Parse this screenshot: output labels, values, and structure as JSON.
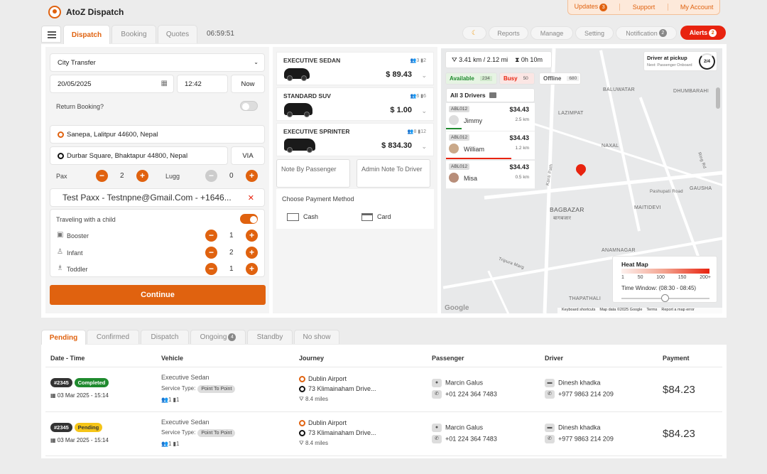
{
  "app": {
    "title": "AtoZ Dispatch"
  },
  "toplinks": {
    "updates": "Updates",
    "updates_count": "3",
    "support": "Support",
    "account": "My Account"
  },
  "tabs": [
    {
      "label": "Dispatch"
    },
    {
      "label": "Booking"
    },
    {
      "label": "Quotes"
    }
  ],
  "clock": "06:59:51",
  "right_tabs": {
    "theme": "☾",
    "reports": "Reports",
    "manage": "Manage",
    "setting": "Setting",
    "notification": "Notification",
    "notification_count": "2",
    "alerts": "Alerts",
    "alerts_count": "2"
  },
  "booking": {
    "transfer_type": "City Transfer",
    "date": "20/05/2025",
    "time": "12:42",
    "now_label": "Now",
    "return_label": "Return Booking?",
    "pickup": "Sanepa, Lalitpur 44600, Nepal",
    "dropoff": "Durbar Square, Bhaktapur 44800, Nepal",
    "via_label": "VIA",
    "pax_label": "Pax",
    "pax_value": "2",
    "lugg_label": "Lugg",
    "lugg_value": "0",
    "passenger": "Test Paxx - Testnpne@Gmail.Com - +1646...",
    "child_label": "Traveling with a child",
    "booster_label": "Booster",
    "booster_value": "1",
    "infant_label": "Infant",
    "infant_value": "2",
    "toddler_label": "Toddler",
    "toddler_value": "1",
    "continue_label": "Continue"
  },
  "vehicles": [
    {
      "name": "EXECUTIVE SEDAN",
      "price": "$ 89.43",
      "pax": "3",
      "bags": "2"
    },
    {
      "name": "STANDARD SUV",
      "price": "$ 1.00",
      "pax": "6",
      "bags": "6"
    },
    {
      "name": "EXECUTIVE SPRINTER",
      "price": "$ 834.30",
      "pax": "8",
      "bags": "12"
    }
  ],
  "notes": {
    "passenger": "Note By Passenger",
    "admin": "Admin Note To Driver"
  },
  "payment": {
    "title": "Choose Payment Method",
    "cash": "Cash",
    "card": "Card"
  },
  "map": {
    "distance": "3.41 km / 2.12 mi",
    "duration": "0h 10m",
    "driver_status": "Driver at pickup",
    "next": "Next: Passenger Onboard",
    "progress": "2/4",
    "available_label": "Available",
    "available_count": "234",
    "busy_label": "Busy",
    "busy_count": "50",
    "offline_label": "Offline",
    "offline_count": "680",
    "drivers_header": "All 3 Drivers",
    "drivers": [
      {
        "plate": "ABL012",
        "name": "Jimmy",
        "price": "$34.43",
        "km": "2.5 km"
      },
      {
        "plate": "ABL012",
        "name": "William",
        "price": "$34.43",
        "km": "1.2 km"
      },
      {
        "plate": "ABL012",
        "name": "Misa",
        "price": "$34.43",
        "km": "0.5 km"
      }
    ],
    "labels": {
      "baluwatar": "BALUWATAR",
      "dhumbarahi": "DHUMBARAHI",
      "lazimpat": "LAZIMPAT",
      "naxal": "NAXAL",
      "gausha": "GAUSHA",
      "maitidevi": "MAITIDEVI",
      "bagbazar": "BAGBAZAR",
      "bagbazar_np": "बागबजार",
      "anamnagar": "ANAMNAGAR",
      "thapathali": "THAPATHALI",
      "pashupati": "Pashupati Road",
      "kanti": "Kanti Path",
      "tripura": "Tripura Marg",
      "ring": "Ring Rd"
    },
    "heatmap": {
      "title": "Heat Map",
      "scale": [
        "1",
        "50",
        "100",
        "150",
        "200+"
      ],
      "window": "Time Window: (08:30 - 08:45)"
    },
    "footer": {
      "google": "Google",
      "shortcuts": "Keyboard shortcuts",
      "mapdata": "Map data ©2025 Google",
      "terms": "Terms",
      "report": "Report a map error"
    }
  },
  "bottom_tabs": [
    {
      "label": "Pending"
    },
    {
      "label": "Confirmed"
    },
    {
      "label": "Dispatch"
    },
    {
      "label": "Ongoing",
      "count": "4"
    },
    {
      "label": "Standby"
    },
    {
      "label": "No show"
    }
  ],
  "table": {
    "headers": [
      "Date - Time",
      "Vehicle",
      "Journey",
      "Passenger",
      "Driver",
      "Payment"
    ],
    "rows": [
      {
        "id": "#2345",
        "status": "Completed",
        "date": "03 Mar 2025 - 15:14",
        "vehicle": "Executive Sedan",
        "service_label": "Service Type:",
        "service": "Point To Point",
        "pax": "1",
        "bags": "1",
        "from": "Dublin Airport",
        "to": "73 Klimainaham Drive...",
        "miles": "8.4 miles",
        "passenger": "Marcin Galus",
        "pphone": "+01 224 364 7483",
        "driver": "Dinesh khadka",
        "dphone": "+977 9863 214 209",
        "payment": "$84.23"
      },
      {
        "id": "#2345",
        "status": "Pending",
        "date": "03 Mar 2025 - 15:14",
        "vehicle": "Executive Sedan",
        "service_label": "Service Type:",
        "service": "Point To Point",
        "pax": "1",
        "bags": "1",
        "from": "Dublin Airport",
        "to": "73 Klimainaham Drive...",
        "miles": "8.4 miles",
        "passenger": "Marcin Galus",
        "pphone": "+01 224 364 7483",
        "driver": "Dinesh khadka",
        "dphone": "+977 9863 214 209",
        "payment": "$84.23"
      }
    ]
  },
  "colors": {
    "accent": "#e0620f",
    "alert": "#e8230f",
    "completed": "#1f8a2e",
    "pending": "#f5c518"
  }
}
